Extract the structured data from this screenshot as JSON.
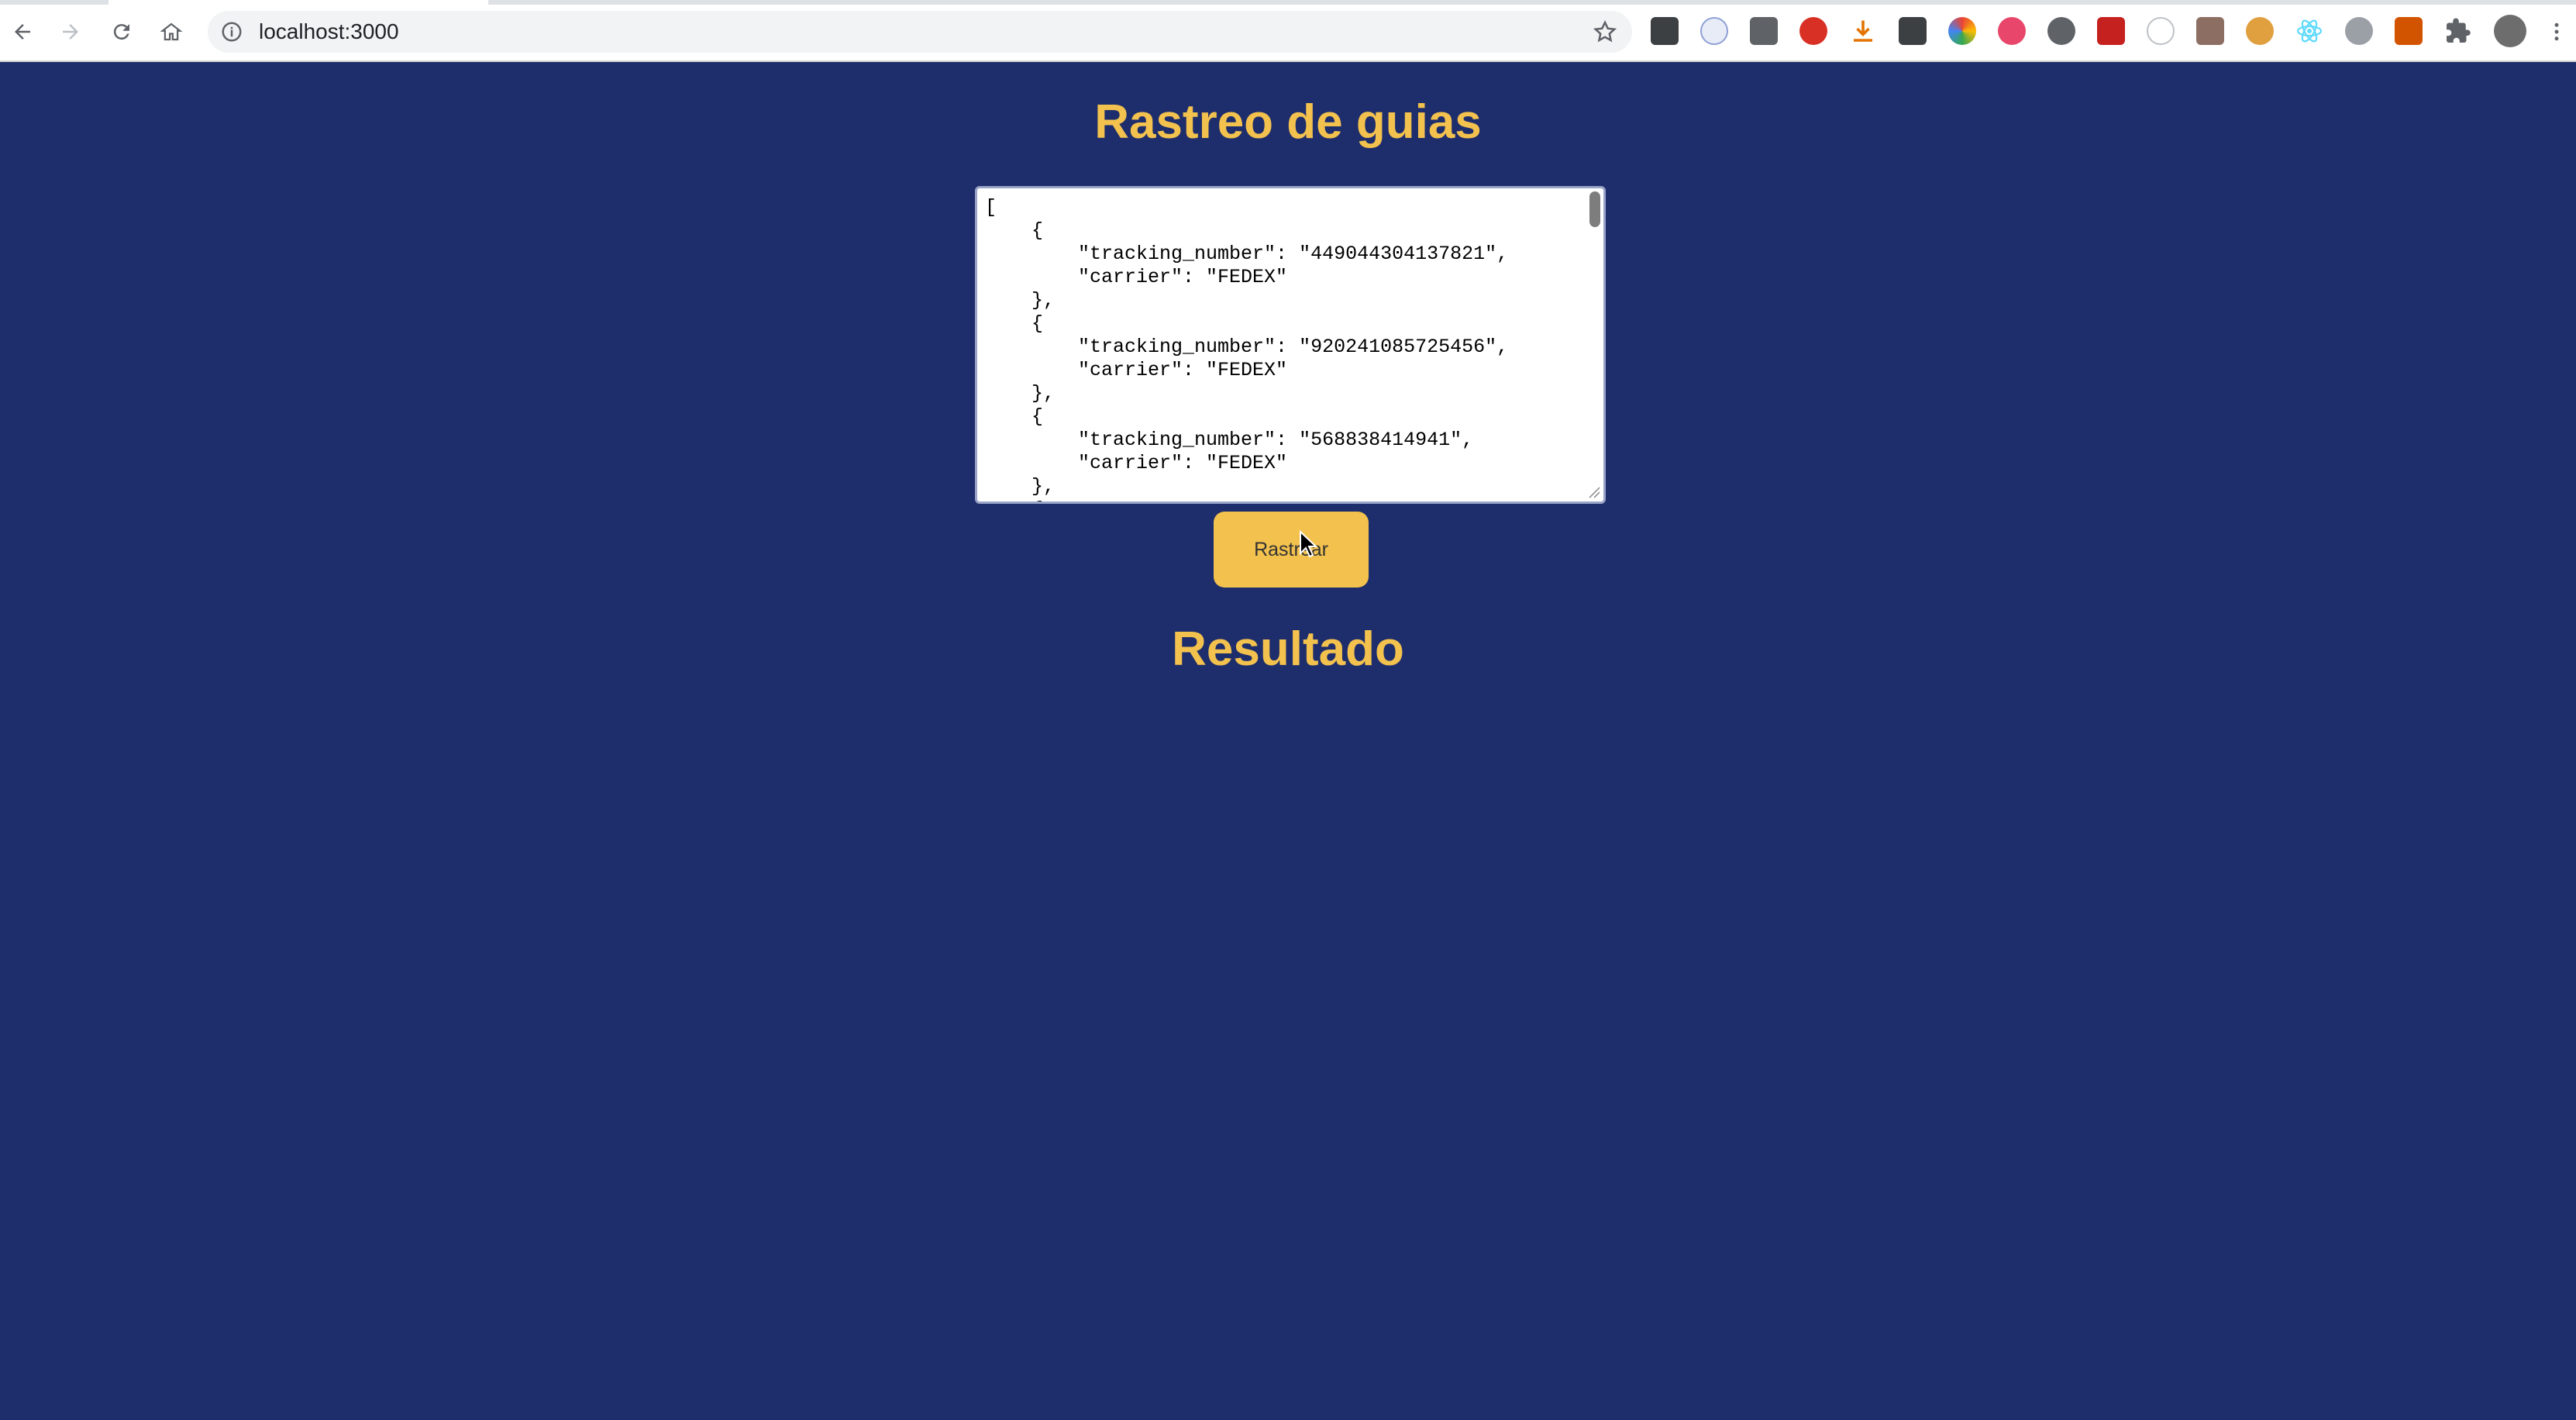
{
  "browser": {
    "url": "localhost:3000",
    "extensions": [
      "download-arrow-icon",
      "cloud-icon",
      "calendar-icon",
      "adblock-icon",
      "download-icon",
      "m-icon",
      "color-wheel-icon",
      "t-icon",
      "circle-icon",
      "photo-icon",
      "globe-icon",
      "film-icon",
      "cookie-icon",
      "react-icon",
      "compass-icon",
      "figure-icon",
      "puzzle-icon",
      "profile-avatar-icon"
    ]
  },
  "main": {
    "title": "Rastreo de guias",
    "json_input_value": "[\n    {\n        \"tracking_number\": \"449044304137821\",\n        \"carrier\": \"FEDEX\"\n    },\n    {\n        \"tracking_number\": \"920241085725456\",\n        \"carrier\": \"FEDEX\"\n    },\n    {\n        \"tracking_number\": \"568838414941\",\n        \"carrier\": \"FEDEX\"\n    },\n    {",
    "track_button_label": "Rastrear",
    "result_title": "Resultado"
  },
  "colors": {
    "background": "#1e2d6b",
    "accent": "#f2c14e"
  }
}
